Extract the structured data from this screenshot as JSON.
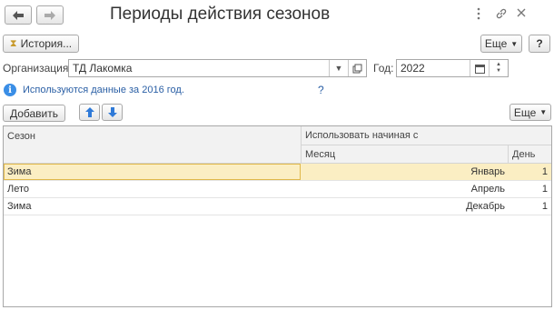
{
  "window": {
    "title": "Периоды действия сезонов",
    "back_icon": "arrow-left-icon",
    "forward_icon": "arrow-right-icon",
    "more_icon": "kebab-icon",
    "link_icon": "link-icon",
    "close_icon": "close-icon"
  },
  "toolbar": {
    "history_label": "История...",
    "more_label": "Еще",
    "help_label": "?"
  },
  "form": {
    "org_label": "Организация:",
    "org_value": "ТД Лакомка",
    "year_label": "Год:",
    "year_value": "2022",
    "info_text": "Используются данные за 2016 год.",
    "info_help": "?"
  },
  "table_toolbar": {
    "add_label": "Добавить",
    "more_label": "Еще"
  },
  "table": {
    "headers": {
      "season": "Сезон",
      "use_from": "Использовать начиная с",
      "month": "Месяц",
      "day": "День"
    },
    "rows": [
      {
        "season": "Зима",
        "month": "Январь",
        "day": "1"
      },
      {
        "season": "Лето",
        "month": "Апрель",
        "day": "1"
      },
      {
        "season": "Зима",
        "month": "Декабрь",
        "day": "1"
      }
    ]
  },
  "colors": {
    "accent_blue": "#2f7ad8",
    "selected_row": "#fbeec3",
    "selected_border": "#e0b84a",
    "link_blue": "#2a5fa5"
  }
}
